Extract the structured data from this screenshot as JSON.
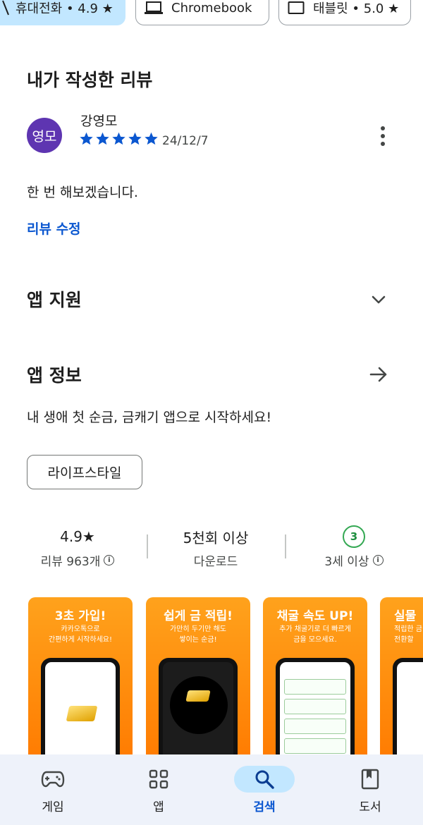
{
  "device_chips": [
    {
      "label": "휴대전화 • 4.9 ★"
    },
    {
      "label": "Chromebook"
    },
    {
      "label": "태블릿 • 5.0 ★"
    }
  ],
  "my_review": {
    "title": "내가 작성한 리뷰",
    "avatar_text": "영모",
    "reviewer": "강영모",
    "rating": 5,
    "date": "24/12/7",
    "text": "한 번 해보겠습니다.",
    "edit_label": "리뷰 수정"
  },
  "app_support": {
    "title": "앱 지원"
  },
  "app_info": {
    "title": "앱 정보",
    "description": "내 생애 첫 순금, 금캐기 앱으로 시작하세요!",
    "category": "라이프스타일"
  },
  "stats": {
    "rating_value": "4.9★",
    "rating_label": "리뷰 963개",
    "downloads_value": "5천회 이상",
    "downloads_label": "다운로드",
    "age_value": "3",
    "age_label": "3세 이상"
  },
  "screenshots": [
    {
      "headline": "3초 가입!",
      "sub1": "카카오톡으로",
      "sub2": "간편하게 시작하세요!"
    },
    {
      "headline": "쉽게 금 적립!",
      "sub1": "가만히 두기만 해도",
      "sub2": "쌓이는 순금!"
    },
    {
      "headline": "채굴 속도 UP!",
      "sub1": "추가 채굴기로 더 빠르게",
      "sub2": "금을 모으세요."
    },
    {
      "headline": "실물",
      "sub1": "적립한 금",
      "sub2": "전환할"
    }
  ],
  "bottom_nav": [
    {
      "label": "게임",
      "icon": "gamepad-icon"
    },
    {
      "label": "앱",
      "icon": "apps-grid-icon"
    },
    {
      "label": "검색",
      "icon": "search-icon",
      "active": true
    },
    {
      "label": "도서",
      "icon": "book-icon"
    }
  ],
  "colors": {
    "accent": "#0b57d0",
    "avatar": "#5e35b1",
    "star": "#0b57d0",
    "age_green": "#34a853"
  }
}
